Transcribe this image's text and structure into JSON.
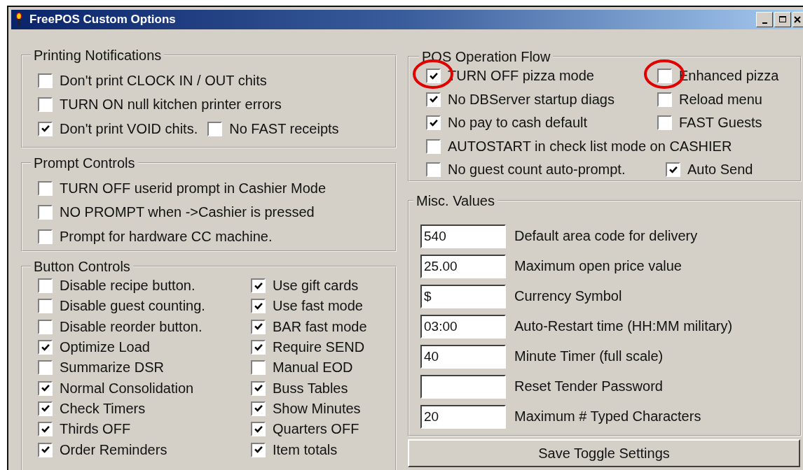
{
  "window": {
    "title": "FreePOS Custom Options"
  },
  "printing_notifications": {
    "title": "Printing  Notifications",
    "rows": [
      {
        "items": [
          {
            "label": "Don't print CLOCK IN / OUT chits",
            "checked": false
          }
        ]
      },
      {
        "items": [
          {
            "label": "TURN ON null kitchen printer errors",
            "checked": false
          }
        ]
      },
      {
        "items": [
          {
            "label": "Don't print VOID chits.",
            "checked": true
          },
          {
            "label": "No FAST receipts",
            "checked": false
          }
        ]
      }
    ]
  },
  "prompt_controls": {
    "title": "Prompt Controls",
    "rows": [
      {
        "items": [
          {
            "label": "TURN OFF userid prompt in Cashier Mode",
            "checked": false
          }
        ]
      },
      {
        "items": [
          {
            "label": "NO PROMPT when ->Cashier is pressed",
            "checked": false
          }
        ]
      },
      {
        "items": [
          {
            "label": "Prompt for hardware CC machine.",
            "checked": false
          }
        ]
      }
    ]
  },
  "button_controls": {
    "title": "Button Controls",
    "columns": [
      [
        {
          "label": "Disable recipe button.",
          "checked": false
        },
        {
          "label": "Disable guest counting.",
          "checked": false
        },
        {
          "label": "Disable reorder button.",
          "checked": false
        },
        {
          "label": "Optimize Load",
          "checked": true
        },
        {
          "label": "Summarize DSR",
          "checked": false
        },
        {
          "label": "Normal Consolidation",
          "checked": true
        },
        {
          "label": "Check Timers",
          "checked": true
        },
        {
          "label": "Thirds OFF",
          "checked": true
        },
        {
          "label": "Order Reminders",
          "checked": true
        }
      ],
      [
        {
          "label": "Use gift cards",
          "checked": true
        },
        {
          "label": "Use fast mode",
          "checked": true
        },
        {
          "label": "BAR fast mode",
          "checked": true
        },
        {
          "label": "Require SEND",
          "checked": true
        },
        {
          "label": "Manual EOD",
          "checked": false
        },
        {
          "label": "Buss Tables",
          "checked": true
        },
        {
          "label": "Show Minutes",
          "checked": true
        },
        {
          "label": "Quarters OFF",
          "checked": true
        },
        {
          "label": "Item totals",
          "checked": true
        }
      ]
    ]
  },
  "pos_operation_flow": {
    "title": "POS Operation Flow",
    "rows": [
      {
        "items": [
          {
            "label": "TURN OFF pizza mode",
            "checked": true,
            "circled": true
          },
          {
            "label": "Enhanced pizza",
            "checked": false,
            "circled": true
          }
        ]
      },
      {
        "items": [
          {
            "label": "No DBServer startup diags",
            "checked": true,
            "circled": false
          },
          {
            "label": "Reload menu",
            "checked": false,
            "circled": false
          }
        ]
      },
      {
        "items": [
          {
            "label": "No pay to cash default",
            "checked": true,
            "circled": false
          },
          {
            "label": "FAST Guests",
            "checked": false,
            "circled": false
          }
        ]
      },
      {
        "items": [
          {
            "label": "AUTOSTART in check list mode on CASHIER",
            "checked": false,
            "circled": false
          }
        ]
      },
      {
        "items": [
          {
            "label": "No guest count auto-prompt.",
            "checked": false,
            "circled": false
          },
          {
            "label": "Auto Send",
            "checked": true,
            "circled": false
          }
        ]
      }
    ]
  },
  "misc_values": {
    "title": "Misc. Values",
    "fields": [
      {
        "value": "540",
        "label": "Default area code for delivery"
      },
      {
        "value": "25.00",
        "label": "Maximum open price value"
      },
      {
        "value": "$",
        "label": "Currency Symbol"
      },
      {
        "value": "03:00",
        "label": "Auto-Restart time (HH:MM military)"
      },
      {
        "value": "40",
        "label": "Minute Timer (full scale)"
      },
      {
        "label": "Reset Tender Password"
      },
      {
        "value": "20",
        "label": "Maximum # Typed Characters"
      }
    ]
  },
  "save_button": {
    "label": "Save Toggle Settings"
  }
}
